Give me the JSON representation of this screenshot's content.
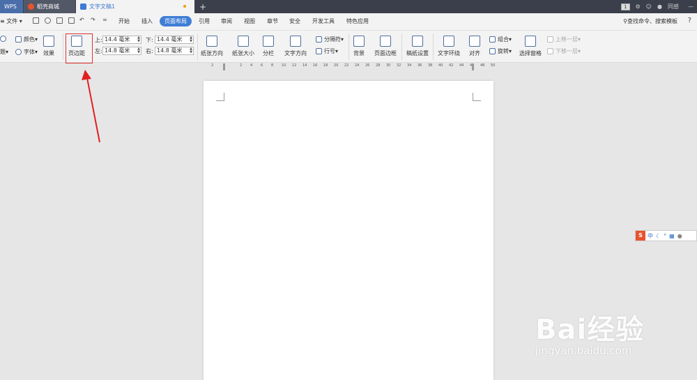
{
  "titlebar": {
    "tabs": [
      {
        "label": "WPS"
      },
      {
        "label": "稻壳商城"
      },
      {
        "label": "文字文稿1"
      }
    ],
    "new_tab_symbol": "+",
    "window_count": "1",
    "sync_label": "同感",
    "minimize_symbol": "—"
  },
  "menubar": {
    "file_label": "文件",
    "items": [
      "开始",
      "插入",
      "页面布局",
      "引用",
      "审阅",
      "视图",
      "章节",
      "安全",
      "开发工具",
      "特色应用"
    ],
    "active_item": "页面布局",
    "search_label": "查找命令、搜索模板",
    "help_symbol": "?"
  },
  "ribbon": {
    "theme_label": "题",
    "color_label": "颜色",
    "font_label": "字体",
    "effect_label": "效果",
    "margins_label": "页边距",
    "margins": {
      "top_label": "上:",
      "top_value": "14.4 毫米",
      "bottom_label": "下:",
      "bottom_value": "14.4 毫米",
      "left_label": "左:",
      "left_value": "14.8 毫米",
      "right_label": "右:",
      "right_value": "14.8 毫米"
    },
    "orientation_label": "纸张方向",
    "size_label": "纸张大小",
    "columns_label": "分栏",
    "text_direction_label": "文字方向",
    "breaks_label": "分隔符",
    "line_numbers_label": "行号",
    "background_label": "背景",
    "page_border_label": "页面边框",
    "draft_settings_label": "稿纸设置",
    "text_wrap_label": "文字环绕",
    "align_label": "对齐",
    "group_label": "组合",
    "rotate_label": "旋转",
    "selection_pane_label": "选择窗格",
    "bring_forward_label": "上移一层",
    "send_backward_label": "下移一层"
  },
  "ruler": {
    "ticks": [
      "2",
      "2",
      "4",
      "6",
      "8",
      "10",
      "12",
      "14",
      "16",
      "18",
      "20",
      "22",
      "24",
      "26",
      "28",
      "30",
      "32",
      "34",
      "36",
      "38",
      "40",
      "42",
      "44",
      "46",
      "48",
      "50"
    ]
  },
  "ime": {
    "logo": "S",
    "mode": "中"
  },
  "watermark": {
    "brand": "Bai经验",
    "url": "jingyan.baidu.com"
  },
  "colors": {
    "accent": "#3f7ed6",
    "titlebar": "#3a3f4b",
    "highlight_box": "#e03030"
  }
}
